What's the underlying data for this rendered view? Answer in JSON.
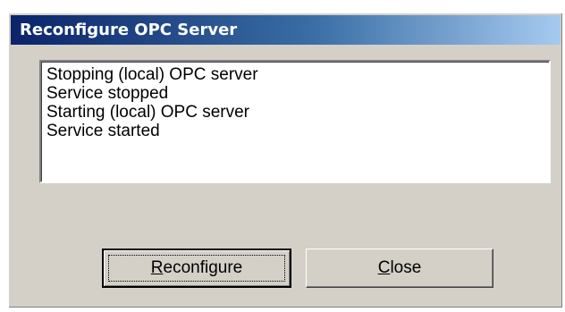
{
  "window": {
    "title": "Reconfigure OPC Server"
  },
  "log": {
    "lines": [
      "Stopping (local) OPC server",
      "Service stopped",
      "Starting (local) OPC server",
      "Service started"
    ]
  },
  "buttons": {
    "reconfigure": {
      "accel": "R",
      "rest": "econfigure"
    },
    "close": {
      "accel": "C",
      "rest": "lose"
    }
  }
}
